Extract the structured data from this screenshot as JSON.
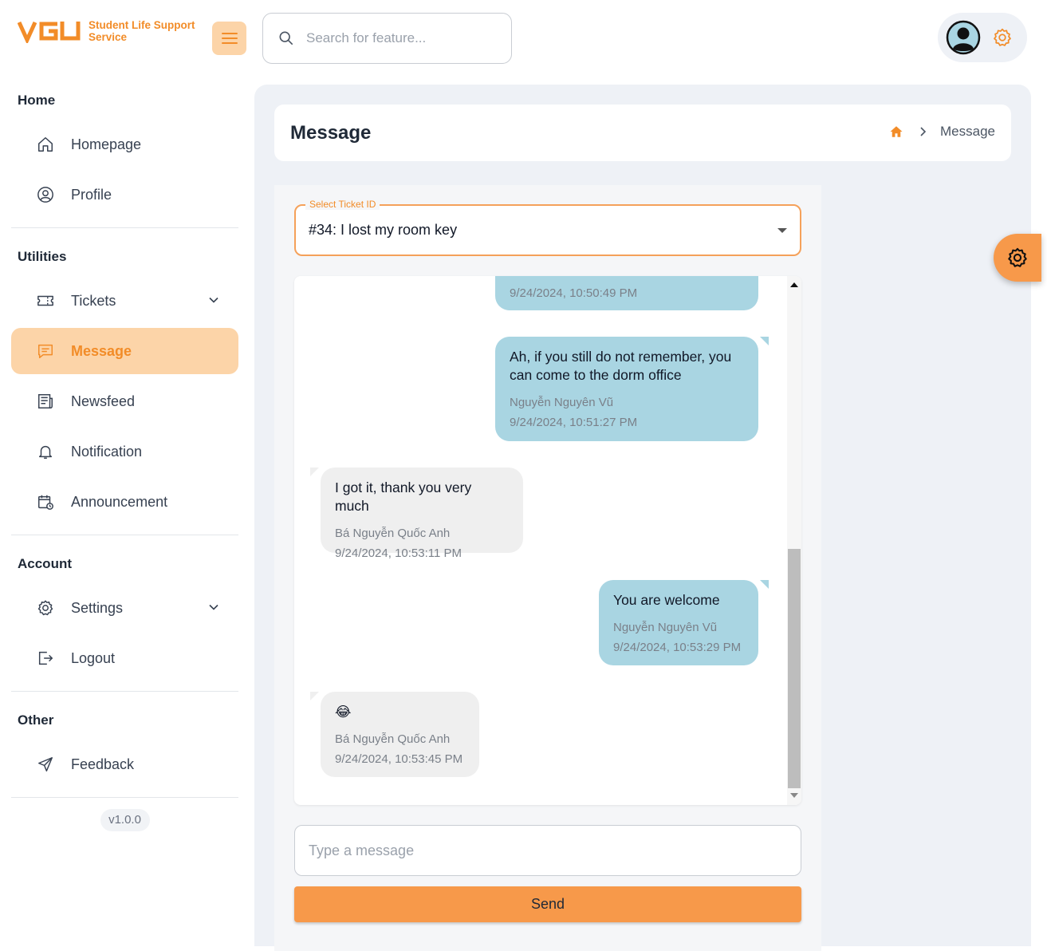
{
  "brand": {
    "logo_text": "VGU",
    "service_name": "Student Life Support Service",
    "accent_color": "#f28c28"
  },
  "header": {
    "search_placeholder": "Search for feature..."
  },
  "sidebar": {
    "sections": [
      {
        "title": "Home",
        "items": [
          {
            "label": "Homepage",
            "icon": "home-icon"
          },
          {
            "label": "Profile",
            "icon": "user-circle-icon"
          }
        ]
      },
      {
        "title": "Utilities",
        "items": [
          {
            "label": "Tickets",
            "icon": "ticket-icon",
            "expandable": true
          },
          {
            "label": "Message",
            "icon": "message-icon",
            "active": true
          },
          {
            "label": "Newsfeed",
            "icon": "newspaper-icon"
          },
          {
            "label": "Notification",
            "icon": "bell-icon"
          },
          {
            "label": "Announcement",
            "icon": "calendar-clock-icon"
          }
        ]
      },
      {
        "title": "Account",
        "items": [
          {
            "label": "Settings",
            "icon": "gear-icon",
            "expandable": true
          },
          {
            "label": "Logout",
            "icon": "logout-icon"
          }
        ]
      },
      {
        "title": "Other",
        "items": [
          {
            "label": "Feedback",
            "icon": "send-icon"
          }
        ]
      }
    ],
    "version": "v1.0.0"
  },
  "page": {
    "title": "Message",
    "breadcrumb_current": "Message"
  },
  "ticket_select": {
    "label": "Select Ticket ID",
    "value": "#34: I lost my room key"
  },
  "messages": [
    {
      "direction": "out",
      "text": "",
      "sender": "",
      "time": "9/24/2024, 10:50:49 PM"
    },
    {
      "direction": "out",
      "text": "Ah, if you still do not remember, you can come to the dorm office",
      "sender": "Nguyễn Nguyên Vũ",
      "time": "9/24/2024, 10:51:27 PM"
    },
    {
      "direction": "in",
      "text": "I got it, thank you very much",
      "sender": "Bá Nguyễn Quốc Anh",
      "time": "9/24/2024, 10:53:11 PM"
    },
    {
      "direction": "out",
      "text": "You are welcome",
      "sender": "Nguyễn Nguyên Vũ",
      "time": "9/24/2024, 10:53:29 PM"
    },
    {
      "direction": "in",
      "text": "😂",
      "sender": "Bá Nguyễn Quốc Anh",
      "time": "9/24/2024, 10:53:45 PM"
    }
  ],
  "composer": {
    "placeholder": "Type a message",
    "send_label": "Send"
  }
}
